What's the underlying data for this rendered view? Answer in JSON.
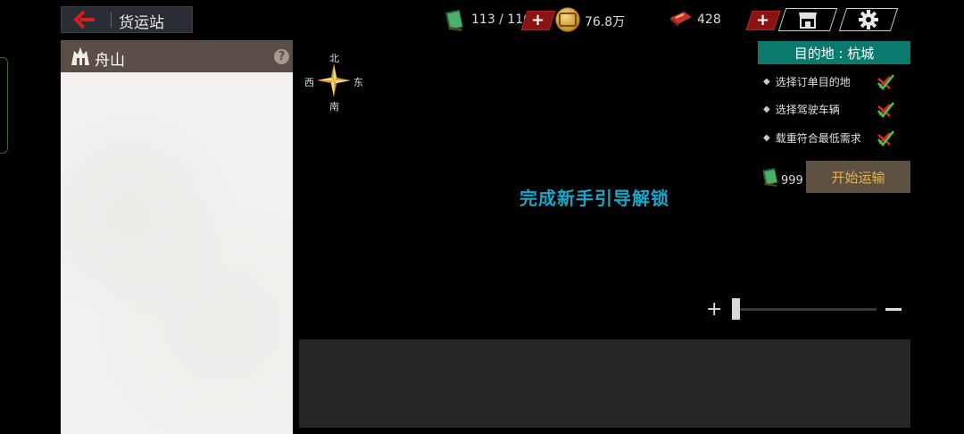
{
  "header": {
    "title": "货运站",
    "back_icon": "back-arrow-icon"
  },
  "resources": {
    "book": {
      "icon": "book-icon",
      "value": "113 / 116"
    },
    "coins": {
      "icon": "coin-icon",
      "value": "76.8万"
    },
    "tickets": {
      "icon": "ticket-icon",
      "value": "428"
    },
    "plus_label": "+"
  },
  "top_buttons": [
    {
      "icon": "shop-icon"
    },
    {
      "icon": "gear-icon"
    }
  ],
  "left_panel": {
    "city_icon": "city-icon",
    "city_name": "舟山",
    "help_label": "?"
  },
  "compass": {
    "north": "北",
    "south": "南",
    "east": "东",
    "west": "西"
  },
  "center_message": "完成新手引导解锁",
  "destination": {
    "header": "目的地 : 杭城",
    "requirements": [
      {
        "label": "选择订单目的地",
        "status": "checked"
      },
      {
        "label": "选择驾驶车辆",
        "status": "checked"
      },
      {
        "label": "载重符合最低需求",
        "status": "checked"
      }
    ],
    "bullet": "◆"
  },
  "transport": {
    "fuel_icon": "book-icon",
    "fuel_count": "999",
    "start_label": "开始运输"
  },
  "zoom": {
    "plus": "+",
    "level": 0.0
  },
  "colors": {
    "accent_teal": "#0a7a6e",
    "message_blue": "#16a7c9",
    "plus_red": "#8a1414",
    "start_gold": "#e8b04a",
    "panel_brown": "#5b4e46"
  }
}
